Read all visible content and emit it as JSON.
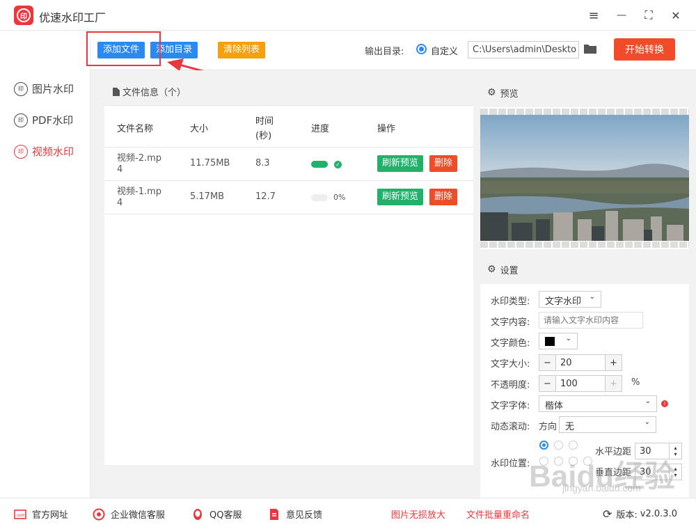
{
  "app": {
    "title": "优速水印工厂",
    "logo_text": "印"
  },
  "window": {
    "menu_icon": "≡",
    "min_icon": "—",
    "max_icon": "⛶",
    "close_icon": "✕"
  },
  "sidebar": {
    "items": [
      {
        "label": "图片水印",
        "active": false
      },
      {
        "label": "PDF水印",
        "active": false
      },
      {
        "label": "视频水印",
        "active": true
      }
    ],
    "icon_text": "印"
  },
  "toolbar": {
    "add_file": "添加文件",
    "add_dir": "添加目录",
    "clear_list": "清除列表",
    "output_label": "输出目录:",
    "output_mode": "自定义",
    "output_path": "C:\\Users\\admin\\Deskto",
    "start": "开始转换"
  },
  "file_panel": {
    "title": "文件信息（个）",
    "columns": {
      "name": "文件名称",
      "size": "大小",
      "time": "时间",
      "time_unit": "(秒)",
      "progress": "进度",
      "actions": "操作"
    },
    "rows": [
      {
        "name_line1": "视频-2.mp",
        "name_line2": "4",
        "size": "11.75MB",
        "time": "8.3",
        "progress": 1.0,
        "progress_text": "",
        "preview": "刷新预览",
        "delete": "删除"
      },
      {
        "name_line1": "视频-1.mp",
        "name_line2": "4",
        "size": "5.17MB",
        "time": "12.7",
        "progress": 0.0,
        "progress_text": "0%",
        "preview": "刷新预览",
        "delete": "删除"
      }
    ]
  },
  "preview": {
    "title": "预览"
  },
  "settings": {
    "title": "设置",
    "watermark_type_label": "水印类型:",
    "watermark_type": "文字水印",
    "text_content_label": "文字内容:",
    "text_content_placeholder": "请输入文字水印内容",
    "text_color_label": "文字颜色:",
    "text_color": "#000000",
    "text_size_label": "文字大小:",
    "text_size": "20",
    "opacity_label": "不透明度:",
    "opacity": "100",
    "percent": "%",
    "font_label": "文字字体:",
    "font": "楷体",
    "scroll_label": "动态滚动:",
    "direction_label": "方向",
    "direction": "无",
    "position_label": "水印位置:",
    "h_margin_label": "水平边距",
    "h_margin": "30",
    "v_margin_label": "垂直边距",
    "v_margin": "30",
    "minus": "−",
    "plus": "+"
  },
  "footer": {
    "website": "官方网址",
    "wechat": "企业微信客服",
    "qq": "QQ客服",
    "feedback": "意见反馈",
    "enlarge": "图片无损放大",
    "rename": "文件批量重命名",
    "version_label": "版本:",
    "version": "v2.0.3.0"
  },
  "watermark": {
    "brand": "Baidu经验",
    "url": "jingyan.baidu.com"
  },
  "colors": {
    "accent": "#e8383d",
    "blue": "#2b8af0",
    "green": "#21b16b",
    "red": "#f04c2a",
    "orange": "#f5a10c"
  }
}
